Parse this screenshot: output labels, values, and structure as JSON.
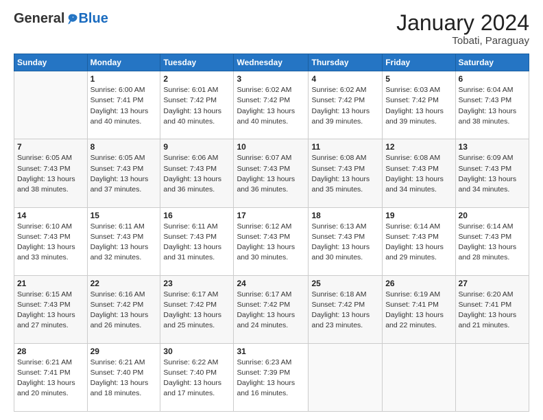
{
  "header": {
    "logo_general": "General",
    "logo_blue": "Blue",
    "month_title": "January 2024",
    "location": "Tobati, Paraguay"
  },
  "weekdays": [
    "Sunday",
    "Monday",
    "Tuesday",
    "Wednesday",
    "Thursday",
    "Friday",
    "Saturday"
  ],
  "weeks": [
    [
      {
        "day": "",
        "sunrise": "",
        "sunset": "",
        "daylight": ""
      },
      {
        "day": "1",
        "sunrise": "Sunrise: 6:00 AM",
        "sunset": "Sunset: 7:41 PM",
        "daylight": "Daylight: 13 hours and 40 minutes."
      },
      {
        "day": "2",
        "sunrise": "Sunrise: 6:01 AM",
        "sunset": "Sunset: 7:42 PM",
        "daylight": "Daylight: 13 hours and 40 minutes."
      },
      {
        "day": "3",
        "sunrise": "Sunrise: 6:02 AM",
        "sunset": "Sunset: 7:42 PM",
        "daylight": "Daylight: 13 hours and 40 minutes."
      },
      {
        "day": "4",
        "sunrise": "Sunrise: 6:02 AM",
        "sunset": "Sunset: 7:42 PM",
        "daylight": "Daylight: 13 hours and 39 minutes."
      },
      {
        "day": "5",
        "sunrise": "Sunrise: 6:03 AM",
        "sunset": "Sunset: 7:42 PM",
        "daylight": "Daylight: 13 hours and 39 minutes."
      },
      {
        "day": "6",
        "sunrise": "Sunrise: 6:04 AM",
        "sunset": "Sunset: 7:43 PM",
        "daylight": "Daylight: 13 hours and 38 minutes."
      }
    ],
    [
      {
        "day": "7",
        "sunrise": "Sunrise: 6:05 AM",
        "sunset": "Sunset: 7:43 PM",
        "daylight": "Daylight: 13 hours and 38 minutes."
      },
      {
        "day": "8",
        "sunrise": "Sunrise: 6:05 AM",
        "sunset": "Sunset: 7:43 PM",
        "daylight": "Daylight: 13 hours and 37 minutes."
      },
      {
        "day": "9",
        "sunrise": "Sunrise: 6:06 AM",
        "sunset": "Sunset: 7:43 PM",
        "daylight": "Daylight: 13 hours and 36 minutes."
      },
      {
        "day": "10",
        "sunrise": "Sunrise: 6:07 AM",
        "sunset": "Sunset: 7:43 PM",
        "daylight": "Daylight: 13 hours and 36 minutes."
      },
      {
        "day": "11",
        "sunrise": "Sunrise: 6:08 AM",
        "sunset": "Sunset: 7:43 PM",
        "daylight": "Daylight: 13 hours and 35 minutes."
      },
      {
        "day": "12",
        "sunrise": "Sunrise: 6:08 AM",
        "sunset": "Sunset: 7:43 PM",
        "daylight": "Daylight: 13 hours and 34 minutes."
      },
      {
        "day": "13",
        "sunrise": "Sunrise: 6:09 AM",
        "sunset": "Sunset: 7:43 PM",
        "daylight": "Daylight: 13 hours and 34 minutes."
      }
    ],
    [
      {
        "day": "14",
        "sunrise": "Sunrise: 6:10 AM",
        "sunset": "Sunset: 7:43 PM",
        "daylight": "Daylight: 13 hours and 33 minutes."
      },
      {
        "day": "15",
        "sunrise": "Sunrise: 6:11 AM",
        "sunset": "Sunset: 7:43 PM",
        "daylight": "Daylight: 13 hours and 32 minutes."
      },
      {
        "day": "16",
        "sunrise": "Sunrise: 6:11 AM",
        "sunset": "Sunset: 7:43 PM",
        "daylight": "Daylight: 13 hours and 31 minutes."
      },
      {
        "day": "17",
        "sunrise": "Sunrise: 6:12 AM",
        "sunset": "Sunset: 7:43 PM",
        "daylight": "Daylight: 13 hours and 30 minutes."
      },
      {
        "day": "18",
        "sunrise": "Sunrise: 6:13 AM",
        "sunset": "Sunset: 7:43 PM",
        "daylight": "Daylight: 13 hours and 30 minutes."
      },
      {
        "day": "19",
        "sunrise": "Sunrise: 6:14 AM",
        "sunset": "Sunset: 7:43 PM",
        "daylight": "Daylight: 13 hours and 29 minutes."
      },
      {
        "day": "20",
        "sunrise": "Sunrise: 6:14 AM",
        "sunset": "Sunset: 7:43 PM",
        "daylight": "Daylight: 13 hours and 28 minutes."
      }
    ],
    [
      {
        "day": "21",
        "sunrise": "Sunrise: 6:15 AM",
        "sunset": "Sunset: 7:43 PM",
        "daylight": "Daylight: 13 hours and 27 minutes."
      },
      {
        "day": "22",
        "sunrise": "Sunrise: 6:16 AM",
        "sunset": "Sunset: 7:42 PM",
        "daylight": "Daylight: 13 hours and 26 minutes."
      },
      {
        "day": "23",
        "sunrise": "Sunrise: 6:17 AM",
        "sunset": "Sunset: 7:42 PM",
        "daylight": "Daylight: 13 hours and 25 minutes."
      },
      {
        "day": "24",
        "sunrise": "Sunrise: 6:17 AM",
        "sunset": "Sunset: 7:42 PM",
        "daylight": "Daylight: 13 hours and 24 minutes."
      },
      {
        "day": "25",
        "sunrise": "Sunrise: 6:18 AM",
        "sunset": "Sunset: 7:42 PM",
        "daylight": "Daylight: 13 hours and 23 minutes."
      },
      {
        "day": "26",
        "sunrise": "Sunrise: 6:19 AM",
        "sunset": "Sunset: 7:41 PM",
        "daylight": "Daylight: 13 hours and 22 minutes."
      },
      {
        "day": "27",
        "sunrise": "Sunrise: 6:20 AM",
        "sunset": "Sunset: 7:41 PM",
        "daylight": "Daylight: 13 hours and 21 minutes."
      }
    ],
    [
      {
        "day": "28",
        "sunrise": "Sunrise: 6:21 AM",
        "sunset": "Sunset: 7:41 PM",
        "daylight": "Daylight: 13 hours and 20 minutes."
      },
      {
        "day": "29",
        "sunrise": "Sunrise: 6:21 AM",
        "sunset": "Sunset: 7:40 PM",
        "daylight": "Daylight: 13 hours and 18 minutes."
      },
      {
        "day": "30",
        "sunrise": "Sunrise: 6:22 AM",
        "sunset": "Sunset: 7:40 PM",
        "daylight": "Daylight: 13 hours and 17 minutes."
      },
      {
        "day": "31",
        "sunrise": "Sunrise: 6:23 AM",
        "sunset": "Sunset: 7:39 PM",
        "daylight": "Daylight: 13 hours and 16 minutes."
      },
      {
        "day": "",
        "sunrise": "",
        "sunset": "",
        "daylight": ""
      },
      {
        "day": "",
        "sunrise": "",
        "sunset": "",
        "daylight": ""
      },
      {
        "day": "",
        "sunrise": "",
        "sunset": "",
        "daylight": ""
      }
    ]
  ]
}
